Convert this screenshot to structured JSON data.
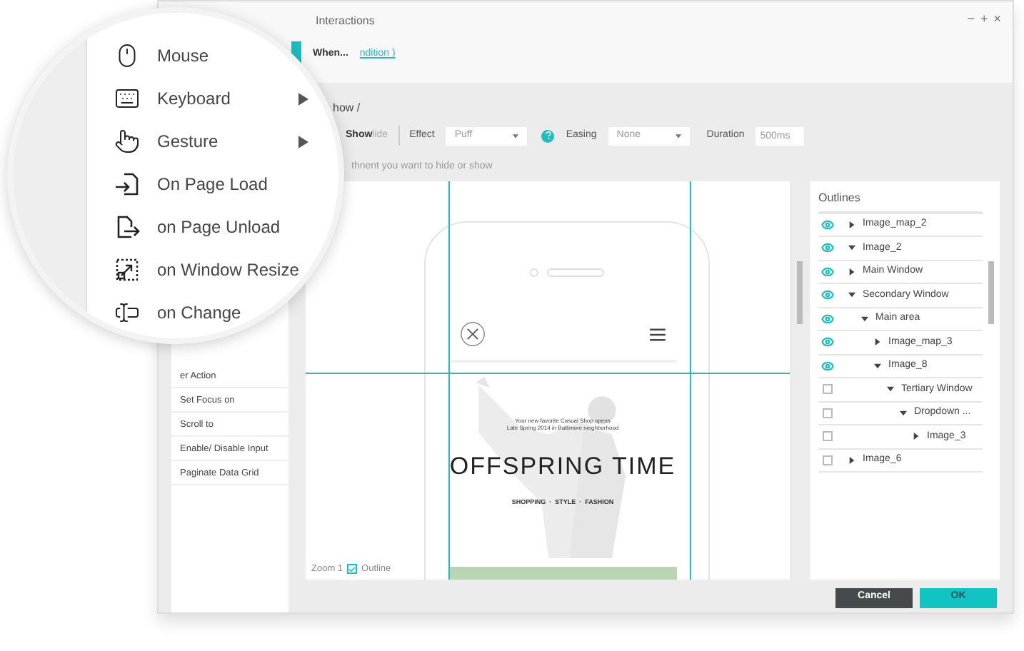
{
  "window": {
    "title": "Interactions",
    "controls": [
      "−",
      "+",
      "×"
    ]
  },
  "trigger_bar": {
    "active_tab": {
      "selected": true
    },
    "label": "When...",
    "link": "ndition )"
  },
  "magnifier_menu": [
    {
      "label": "Mouse",
      "has_submenu": false
    },
    {
      "label": "Keyboard",
      "has_submenu": true
    },
    {
      "label": "Gesture",
      "has_submenu": true
    },
    {
      "label": "On Page Load",
      "has_submenu": false
    },
    {
      "label": "on Page Unload",
      "has_submenu": false
    },
    {
      "label": "on Window Resize",
      "has_submenu": false
    },
    {
      "label": "on Change",
      "has_submenu": false
    }
  ],
  "actions": [
    "er Action",
    "Set Focus on",
    "Scroll to",
    "Enable/ Disable Input",
    "Paginate Data Grid"
  ],
  "breadcrumb": "how /",
  "toolbar": {
    "toggle": [
      {
        "label": "Show",
        "selected": true
      },
      {
        "label": "lide",
        "selected": false
      }
    ],
    "effect": {
      "label": "Effect",
      "value": "Puff"
    },
    "easing": {
      "label": "Easing",
      "value": "None"
    },
    "duration": {
      "label": "Duration",
      "value": "500ms"
    }
  },
  "hint": "thnent you want to hide or show",
  "canvas": {
    "zoom_label": "Zoom 1",
    "outline": {
      "label": "Outline",
      "checked": true
    },
    "page": {
      "tagline": [
        "Your new favorite Casual Shop opens",
        "Late Spring 2014 in Baltimore neighborhood"
      ],
      "title": "OFFSPRING TIME",
      "nav": "SHOPPING  ·  STYLE  ·  FASHION"
    }
  },
  "outlines": {
    "title": "Outlines",
    "items": [
      {
        "label": "Image_map_2",
        "visible": true,
        "expanded": false
      },
      {
        "label": "Image_2",
        "visible": true,
        "expanded": true
      },
      {
        "label": "Main Window",
        "visible": true,
        "expanded": false
      },
      {
        "label": "Secondary Window",
        "visible": true,
        "expanded": true,
        "children": [
          {
            "label": "Main area",
            "visible": true,
            "expanded": true,
            "children": [
              {
                "label": "Image_map_3",
                "visible": true,
                "expanded": false
              },
              {
                "label": "Image_8",
                "visible": true,
                "expanded": true,
                "children": [
                  {
                    "label": "Tertiary Window",
                    "visible": false,
                    "expanded": true,
                    "children": [
                      {
                        "label": "Dropdown ...",
                        "visible": false,
                        "expanded": true,
                        "children": [
                          {
                            "label": "Image_3",
                            "visible": false,
                            "expanded": false
                          }
                        ]
                      }
                    ]
                  }
                ]
              }
            ]
          }
        ]
      },
      {
        "label": "Image_6",
        "visible": false,
        "expanded": false
      }
    ]
  },
  "buttons": [
    {
      "label": "Cancel",
      "kind": "secondary"
    },
    {
      "label": "OK",
      "kind": "primary"
    }
  ]
}
